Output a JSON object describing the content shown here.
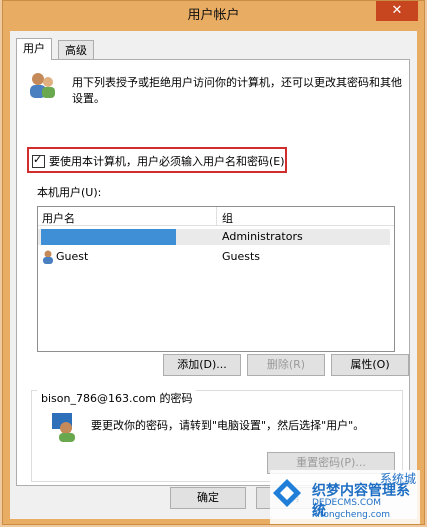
{
  "window": {
    "title": "用户帐户",
    "close_glyph": "✕"
  },
  "tabs": [
    {
      "label": "用户"
    },
    {
      "label": "高级"
    }
  ],
  "intro": {
    "text_line1": "用下列表授予或拒绝用户访问你的计算机，还可以更改其密码和其他",
    "text_line2": "设置。"
  },
  "checkbox": {
    "label": "要使用本计算机，用户必须输入用户名和密码(E)",
    "checked": true
  },
  "users_label": "本机用户(U):",
  "table": {
    "columns": [
      "用户名",
      "组"
    ],
    "rows": [
      {
        "name": "",
        "group": "Administrators",
        "selected": true
      },
      {
        "name": "Guest",
        "group": "Guests",
        "selected": false
      }
    ]
  },
  "buttons": {
    "add": "添加(D)...",
    "remove": "删除(R)",
    "properties": "属性(O)"
  },
  "password_group": {
    "title": "bison_786@163.com 的密码",
    "text": "要更改你的密码，请转到\"电脑设置\"，然后选择\"用户\"。",
    "reset": "重置密码(P)..."
  },
  "footer": {
    "ok": "确定",
    "cancel": "消"
  },
  "watermark": {
    "text1": "织梦内容管理系统",
    "text2": "DEDECMS.COM",
    "text3": "系统城",
    "text4": "xitongcheng.com"
  },
  "colors": {
    "selection": "#3f8fd6",
    "highlight_box": "#d22d2d",
    "title_bar": "#e8ad63"
  }
}
